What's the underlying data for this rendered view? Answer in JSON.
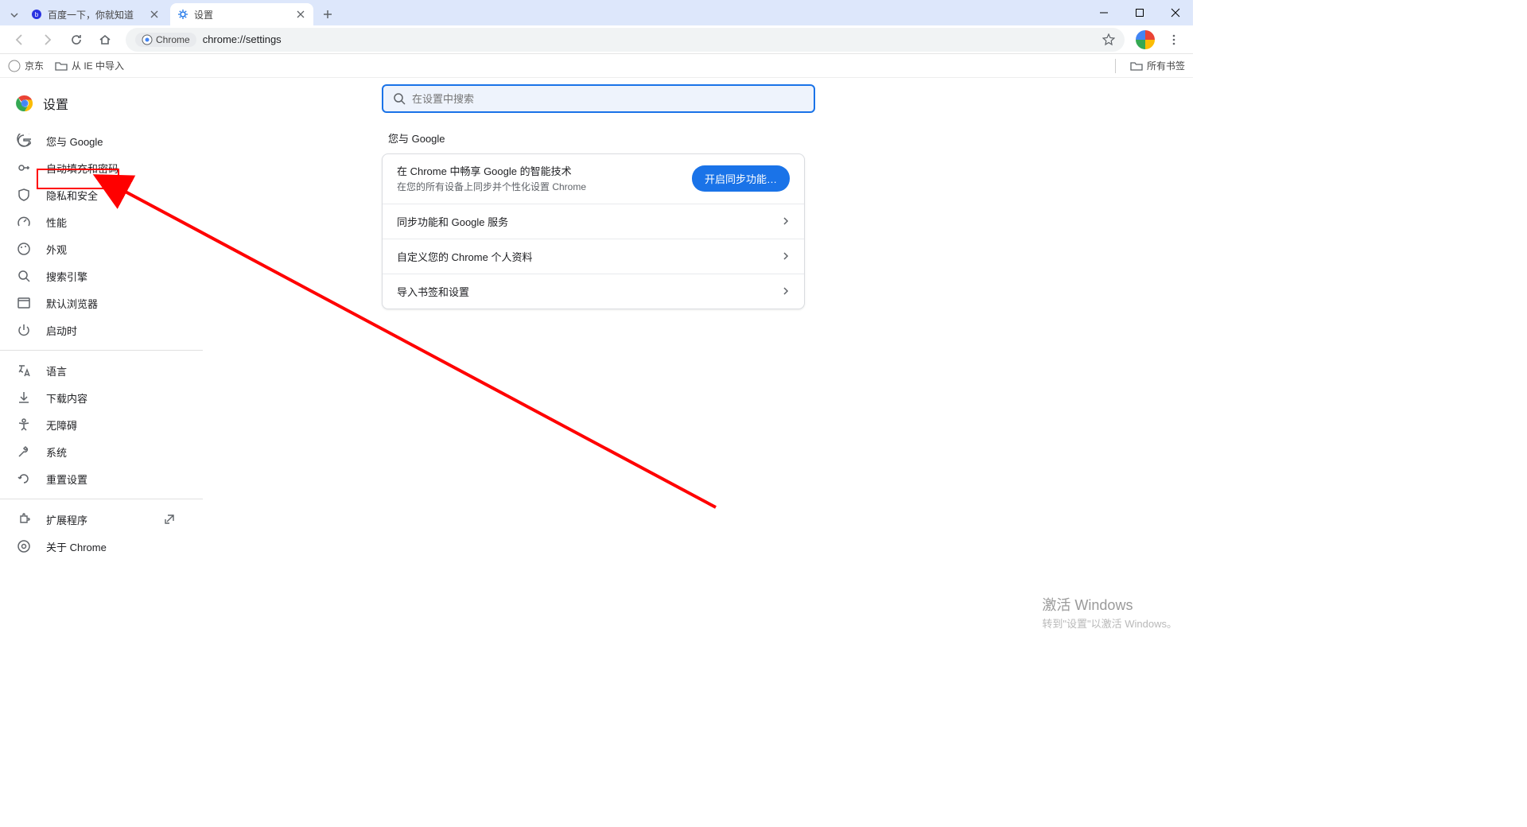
{
  "tabs": [
    {
      "title": "百度一下，你就知道",
      "active": false
    },
    {
      "title": "设置",
      "active": true
    }
  ],
  "omnibox": {
    "chip": "Chrome",
    "url": "chrome://settings"
  },
  "bookmarks": {
    "jd": "京东",
    "ie_import": "从 IE 中导入",
    "all": "所有书签"
  },
  "settings": {
    "title": "设置",
    "search_placeholder": "在设置中搜索",
    "nav": {
      "you_google": "您与 Google",
      "autofill": "自动填充和密码",
      "privacy": "隐私和安全",
      "performance": "性能",
      "appearance": "外观",
      "search_engine": "搜索引擎",
      "default_browser": "默认浏览器",
      "on_startup": "启动时",
      "languages": "语言",
      "downloads": "下载内容",
      "accessibility": "无障碍",
      "system": "系统",
      "reset": "重置设置",
      "extensions": "扩展程序",
      "about": "关于 Chrome"
    },
    "section_title": "您与 Google",
    "card": {
      "line1": "在 Chrome 中畅享 Google 的智能技术",
      "line2": "在您的所有设备上同步并个性化设置 Chrome",
      "sync_btn": "开启同步功能…",
      "row2": "同步功能和 Google 服务",
      "row3": "自定义您的 Chrome 个人资料",
      "row4": "导入书签和设置"
    }
  },
  "watermark": {
    "line1": "激活 Windows",
    "line2": "转到\"设置\"以激活 Windows。"
  }
}
